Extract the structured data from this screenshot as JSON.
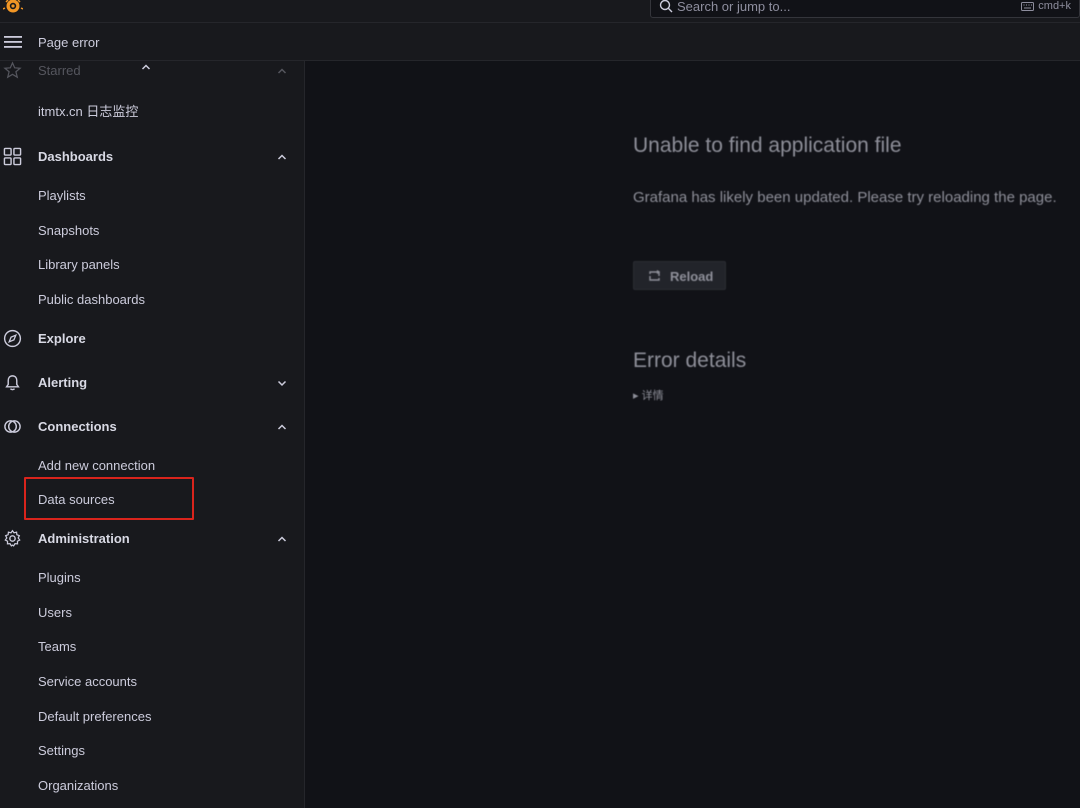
{
  "header": {
    "search_placeholder": "Search or jump to...",
    "search_shortcut": "cmd+k",
    "page_title": "Page error"
  },
  "sidebar": {
    "starred": {
      "label": "Starred",
      "items": [
        "itmtx.cn 日志监控"
      ]
    },
    "dashboards": {
      "label": "Dashboards",
      "items": [
        "Playlists",
        "Snapshots",
        "Library panels",
        "Public dashboards"
      ]
    },
    "explore": {
      "label": "Explore"
    },
    "alerting": {
      "label": "Alerting"
    },
    "connections": {
      "label": "Connections",
      "items": [
        "Add new connection",
        "Data sources"
      ]
    },
    "administration": {
      "label": "Administration",
      "items": [
        "Plugins",
        "Users",
        "Teams",
        "Service accounts",
        "Default preferences",
        "Settings",
        "Organizations"
      ]
    }
  },
  "error": {
    "title": "Unable to find application file",
    "message": "Grafana has likely been updated. Please try reloading the page.",
    "reload_label": "Reload",
    "details_title": "Error details",
    "details_toggle": "▸ 详情"
  },
  "colors": {
    "background": "#111217",
    "panel": "#18191d",
    "highlight_box": "#d9241c",
    "logo": "#f29625"
  }
}
